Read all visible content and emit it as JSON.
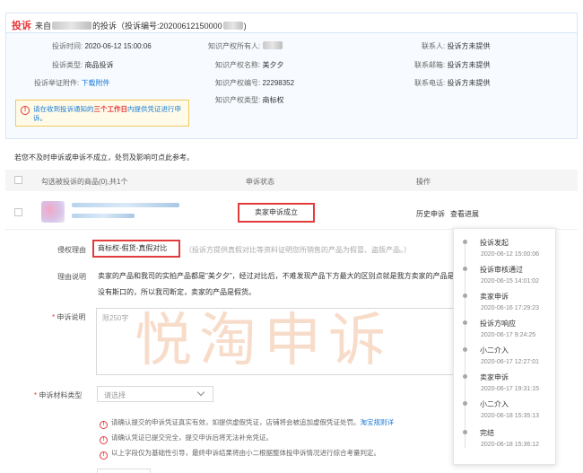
{
  "header": {
    "badge": "投诉",
    "from_prefix": "来自",
    "from_suffix": "的投诉（投诉编号:20200612150000"
  },
  "info": {
    "time_label": "投诉时间:",
    "time_value": "2020-06-12 15:00:06",
    "type_label": "投诉类型:",
    "type_value": "商品投诉",
    "attach_label": "投诉举证附件:",
    "attach_link": "下载附件",
    "owner_label": "知识产权所有人:",
    "ip_name_label": "知识产权名称:",
    "ip_name_value": "美夕夕",
    "ip_no_label": "知识产权编号:",
    "ip_no_value": "22298352",
    "ip_type_label": "知识产权类型:",
    "ip_type_value": "商标权",
    "contact_label": "联系人:",
    "contact_value": "投诉方未提供",
    "email_label": "联系邮箱:",
    "email_value": "投诉方未提供",
    "phone_label": "联系电话:",
    "phone_value": "投诉方未提供"
  },
  "notice": {
    "icon": "!",
    "text_a": "请在收到投诉通知的",
    "text_red": "三个工作日",
    "text_b": "内提供凭证进行申诉。"
  },
  "description": "若您不及时申诉或申诉不成立，处罚及影响可点此参考。",
  "table": {
    "col_product": "勾选被投诉的商品(0),共1个",
    "col_status": "申诉状态",
    "col_action": "操作",
    "status": "卖家申诉成立",
    "action_history": "历史申诉",
    "action_progress": "查看进展"
  },
  "form": {
    "reason_label": "侵权理由",
    "reason_value": "商标权-假货-真假对比",
    "reason_hint": "（投诉方提供真假对比等资料证明您所销售的产品为假冒、盗版产品。）",
    "explain_label": "理由说明",
    "explain_text": "卖家的产品和我司的实拍产品都是\"美夕夕\"，经过对比后，不难发现产品下方最大的区别点就是我方卖家的产品是没有斯口的，所以我司断定，卖家的产品是假货。",
    "appeal_label": "申诉说明",
    "appeal_placeholder": "限250字",
    "material_label": "申诉材料类型",
    "material_select": "请选择"
  },
  "tips": [
    {
      "icon": "!",
      "text": "请确认提交的申诉凭证真实有效，如提供虚假凭证，店铺将会被追加虚假凭证处罚。",
      "link": "淘宝规则详"
    },
    {
      "icon": "!",
      "text": "请确认凭证已提交完全，提交申诉后将无法补充凭证。",
      "link": ""
    },
    {
      "icon": "!",
      "text": "以上字段仅为基础性引导，最终申诉结果将由小二根据整体投申诉情况进行综合考量判定。",
      "link": ""
    }
  ],
  "timeline": [
    {
      "title": "投诉发起",
      "time": "2020-06-12 15:00:06"
    },
    {
      "title": "投诉审核通过",
      "time": "2020-06-15 14:01:02"
    },
    {
      "title": "卖家申诉",
      "time": "2020-06-16 17:29:23"
    },
    {
      "title": "投诉方响应",
      "time": "2020-06-17 9:24:25"
    },
    {
      "title": "小二介入",
      "time": "2020-06-17 12:27:01"
    },
    {
      "title": "卖家申诉",
      "time": "2020-06-17 19:31:15"
    },
    {
      "title": "小二介入",
      "time": "2020-06-18 15:35:13"
    },
    {
      "title": "完结",
      "time": "2020-06-18 15:36:12"
    }
  ],
  "watermark": "悦淘申诉",
  "colors": {
    "accent_red": "#e4393c",
    "link_blue": "#1a7bd6",
    "notice_bg": "#fffbe8"
  }
}
